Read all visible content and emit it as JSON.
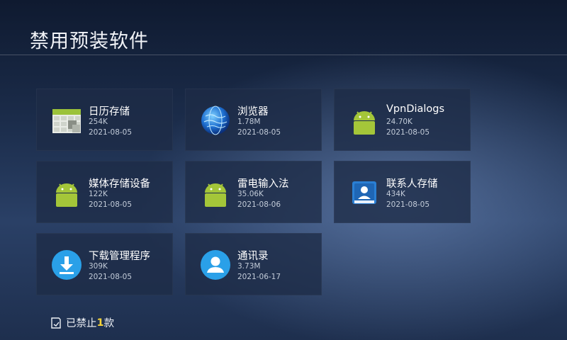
{
  "header": {
    "title": "禁用预装软件"
  },
  "apps": [
    {
      "name": "日历存储",
      "size": "254K",
      "date": "2021-08-05",
      "icon": "calendar-storage-icon"
    },
    {
      "name": "浏览器",
      "size": "1.78M",
      "date": "2021-08-05",
      "icon": "globe-icon"
    },
    {
      "name": "VpnDialogs",
      "size": "24.70K",
      "date": "2021-08-05",
      "icon": "android-icon"
    },
    {
      "name": "媒体存储设备",
      "size": "122K",
      "date": "2021-08-05",
      "icon": "android-icon"
    },
    {
      "name": "雷电输入法",
      "size": "35.06K",
      "date": "2021-08-06",
      "icon": "android-icon"
    },
    {
      "name": "联系人存储",
      "size": "434K",
      "date": "2021-08-05",
      "icon": "contacts-storage-icon"
    },
    {
      "name": "下载管理程序",
      "size": "309K",
      "date": "2021-08-05",
      "icon": "download-icon"
    },
    {
      "name": "通讯录",
      "size": "3.73M",
      "date": "2021-06-17",
      "icon": "person-icon"
    }
  ],
  "footer": {
    "prefix": "已禁止",
    "count": "1",
    "suffix": "款",
    "icon": "note-icon"
  },
  "colors": {
    "accent": "#f5d33a",
    "android_green": "#a4c639",
    "blue": "#2aa0e8"
  }
}
